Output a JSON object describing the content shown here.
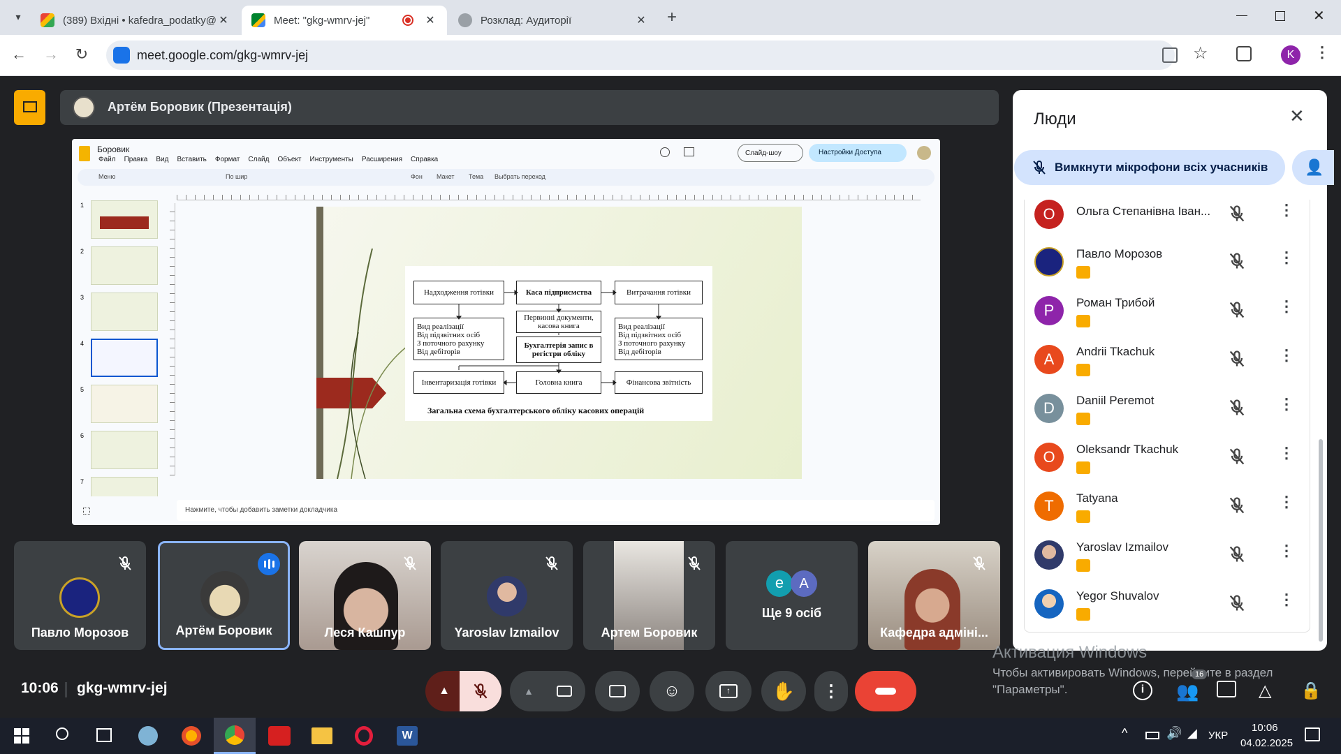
{
  "tabs": [
    {
      "title": "(389) Вхідні • kafedra_podatky@",
      "close": "✕"
    },
    {
      "title": "Meet: \"gkg-wmrv-jej\"",
      "close": "✕"
    },
    {
      "title": "Розклад: Аудиторії",
      "close": "✕"
    }
  ],
  "new_tab": "+",
  "address_bar": {
    "url": "meet.google.com/gkg-wmrv-jej"
  },
  "profile_initial": "K",
  "presentation_bar": {
    "title": "Артём Боровик (Презентація)"
  },
  "slides": {
    "doc_title": "Боровик",
    "menu": [
      "Файл",
      "Правка",
      "Вид",
      "Вставить",
      "Формат",
      "Слайд",
      "Объект",
      "Инструменты",
      "Расширения",
      "Справка"
    ],
    "slideshow_button": "Слайд-шоу",
    "access_button": "Настройки Доступа",
    "toolbar_menu": "Меню",
    "zoom": "По шир",
    "toolbar_items": [
      "Фон",
      "Макет",
      "Тема",
      "Выбрать переход"
    ],
    "thumb_numbers": [
      "1",
      "2",
      "3",
      "4",
      "5",
      "6",
      "7"
    ],
    "notes_placeholder": "Нажмите, чтобы добавить заметки докладчика",
    "diagram": {
      "box1": "Надходження готівки",
      "box2": "Каса підприємства",
      "box3": "Витрачання готівки",
      "box4": "Первинні документи, касова книга",
      "box5": "Бухгалтерія запис в регістри обліку",
      "box6_lines": [
        "Вид реалізації",
        "Від підзвітних осіб",
        "З поточного рахунку",
        "Від дебіторів"
      ],
      "box7_lines": [
        "Вид реалізації",
        "Від підзвітних осіб",
        "З поточного рахунку",
        "Від дебіторів"
      ],
      "box8": "Інвентаризація готівки",
      "box9": "Головна книга",
      "box10": "Фінансова звітність",
      "caption": "Загальна схема бухгалтерського обліку касових операцій"
    }
  },
  "participants_tiles": [
    {
      "name": "Павло Морозов"
    },
    {
      "name": "Артём Боровик"
    },
    {
      "name": "Леся Кашпур"
    },
    {
      "name": "Yaroslav Izmailov"
    },
    {
      "name": "Артем Боровик"
    },
    {
      "name": "Ще 9 осіб",
      "avatars": [
        "e",
        "A"
      ]
    },
    {
      "name": "Кафедра адміні..."
    }
  ],
  "people_panel": {
    "title": "Люди",
    "mute_all": "Вимкнути мікрофони всіх учасників",
    "people": [
      {
        "name": "Ольга Степанівна Іван...",
        "initial": "О",
        "color": "#c5221f"
      },
      {
        "name": "Павло Морозов",
        "initial": "",
        "color": "#1a237e"
      },
      {
        "name": "Роман Трибой",
        "initial": "Р",
        "color": "#8e24aa"
      },
      {
        "name": "Andrii Tkachuk",
        "initial": "A",
        "color": "#e8491d"
      },
      {
        "name": "Daniil Peremot",
        "initial": "D",
        "color": "#78909c"
      },
      {
        "name": "Oleksandr Tkachuk",
        "initial": "O",
        "color": "#e8491d"
      },
      {
        "name": "Tatyana",
        "initial": "T",
        "color": "#ef6c00"
      },
      {
        "name": "Yaroslav Izmailov",
        "initial": "",
        "color": "#5c6bc0"
      },
      {
        "name": "Yegor Shuvalov",
        "initial": "",
        "color": "#1565c0"
      }
    ]
  },
  "meeting_info": {
    "time": "10:06",
    "code": "gkg-wmrv-jej"
  },
  "people_count": "16",
  "watermark": {
    "title": "Активация Windows",
    "line1": "Чтобы активировать Windows, перейдите в раздел",
    "line2": "\"Параметры\"."
  },
  "taskbar": {
    "lang": "УКР",
    "time": "10:06",
    "date": "04.02.2025"
  },
  "colors": {
    "end_call": "#ea4335",
    "mic_off": "#f9dedc",
    "accent_blue": "#8ab4f8"
  }
}
